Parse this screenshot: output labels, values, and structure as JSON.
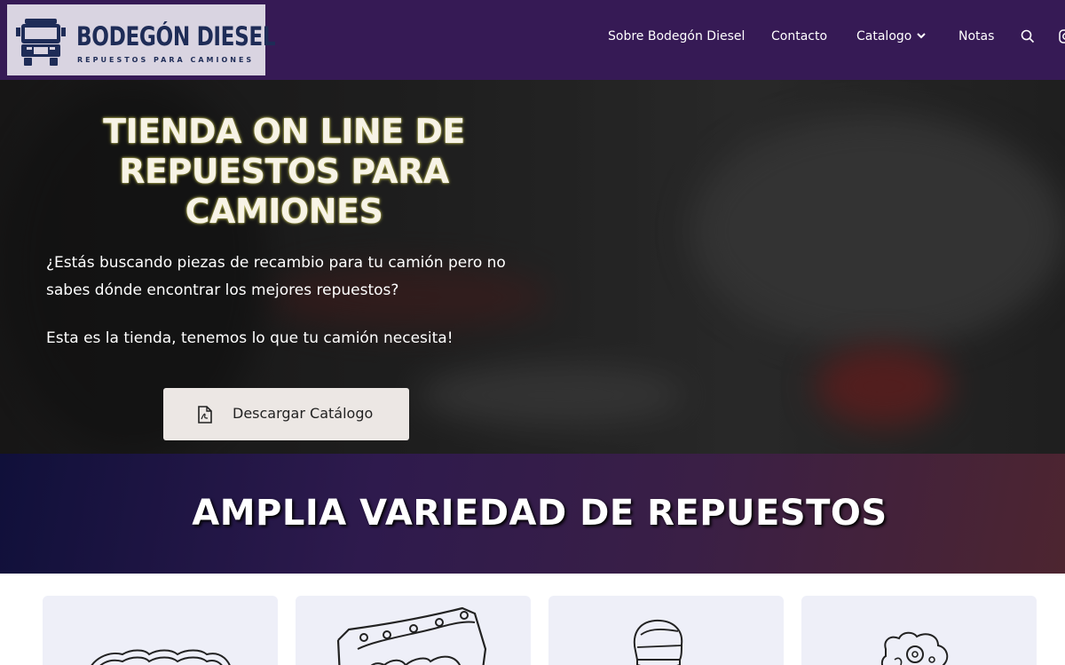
{
  "brand": {
    "name": "BODEGÓN DIESEL",
    "tagline": "REPUESTOS PARA CAMIONES"
  },
  "nav": {
    "items": [
      {
        "label": "Sobre Bodegón Diesel"
      },
      {
        "label": "Contacto"
      },
      {
        "label": "Catalogo"
      },
      {
        "label": "Notas"
      }
    ],
    "icons": [
      "search-icon",
      "instagram-icon"
    ]
  },
  "hero": {
    "title": "TIENDA ON LINE DE REPUESTOS PARA CAMIONES",
    "paragraph1": "¿Estás buscando piezas de recambio para tu camión pero no sabes dónde encontrar los mejores repuestos?",
    "paragraph2": "Esta es la tienda, tenemos lo que tu camión necesita!",
    "cta_label": "Descargar Catálogo",
    "cta_icon": "pdf-file-icon"
  },
  "section": {
    "title": "AMPLIA VARIEDAD DE REPUESTOS"
  },
  "cards": [
    {
      "icon": "engine-gasket-icon"
    },
    {
      "icon": "cylinder-head-icon"
    },
    {
      "icon": "gear-shift-knob-icon"
    },
    {
      "icon": "turbo-pump-icon"
    }
  ],
  "colors": {
    "header_bg": "#361a55",
    "logo_bg": "#d9d4e1",
    "logo_text": "#1e2c57",
    "cta_bg": "#ece7e4",
    "card_bg": "#eeeff8"
  }
}
